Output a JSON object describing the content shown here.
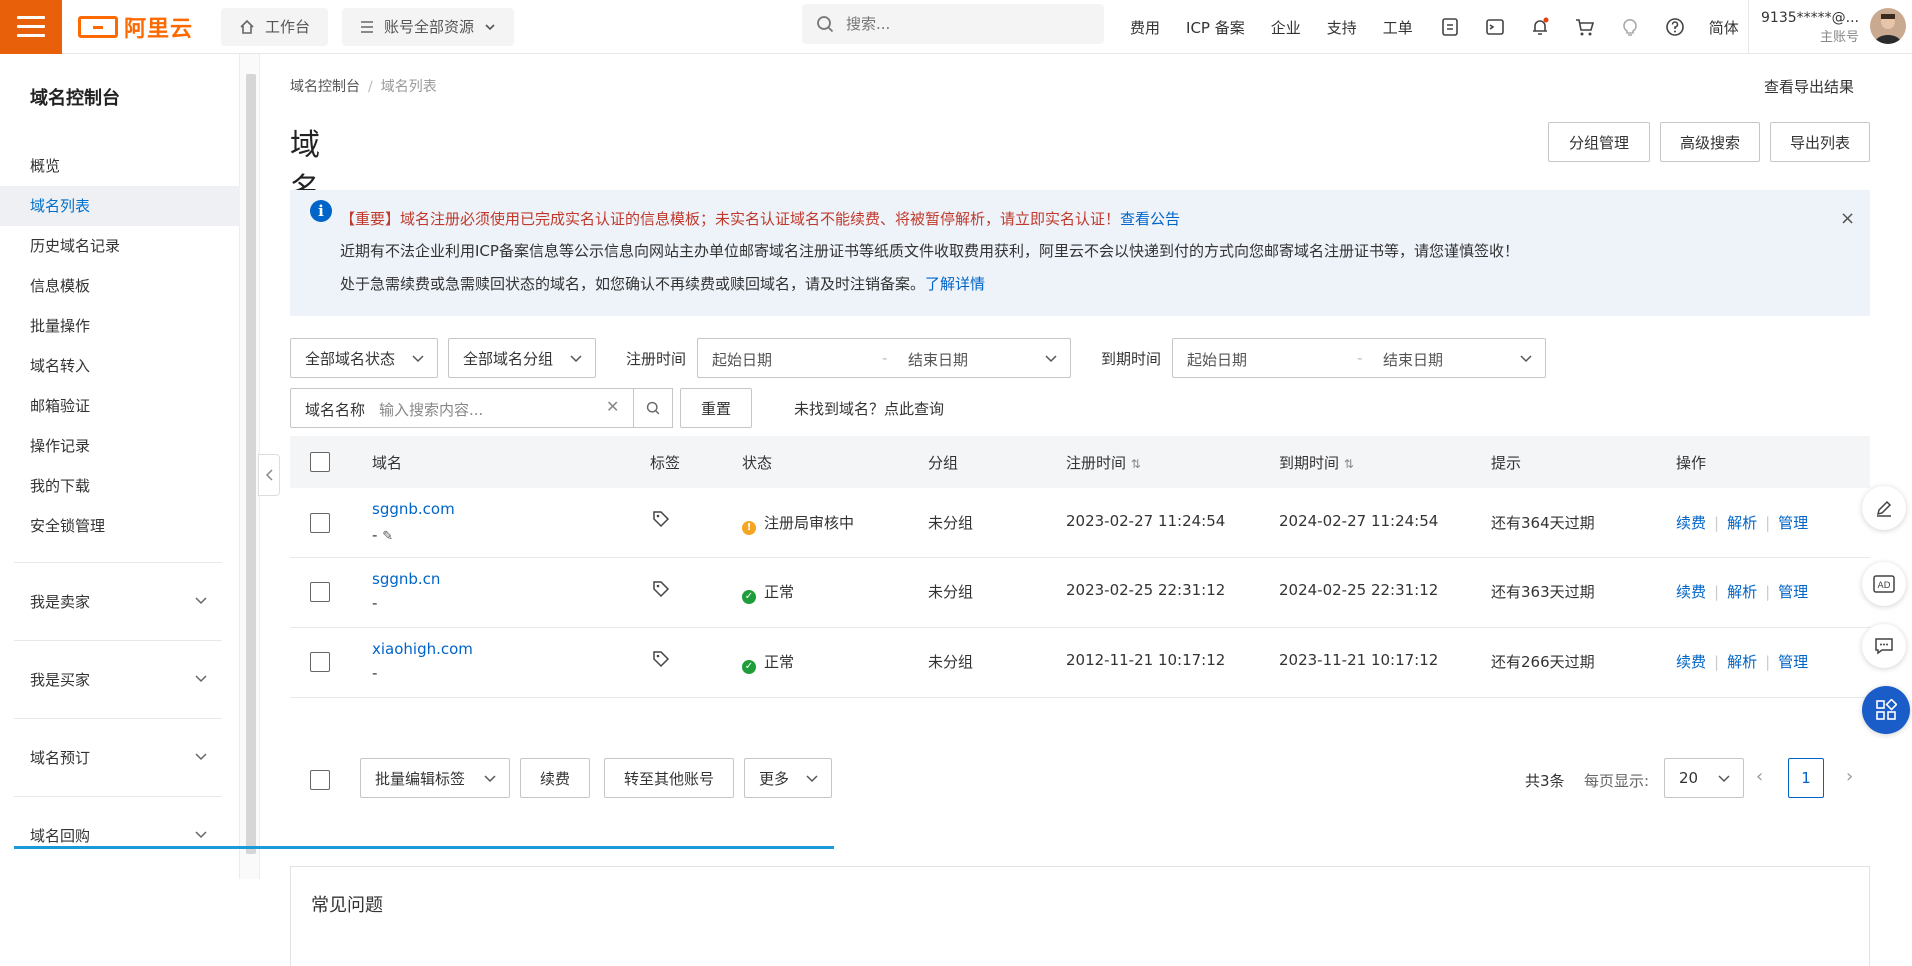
{
  "topbar": {
    "brand": "阿里云",
    "workbench": "工作台",
    "resources": "账号全部资源",
    "search_placeholder": "搜索...",
    "links": [
      "费用",
      "ICP 备案",
      "企业",
      "支持",
      "工单"
    ],
    "lang": "简体",
    "account_name": "9135*****@...",
    "account_type": "主账号"
  },
  "sidebar": {
    "title": "域名控制台",
    "items": [
      {
        "label": "概览",
        "active": false
      },
      {
        "label": "域名列表",
        "active": true
      },
      {
        "label": "历史域名记录",
        "active": false
      },
      {
        "label": "信息模板",
        "active": false
      },
      {
        "label": "批量操作",
        "active": false
      },
      {
        "label": "域名转入",
        "active": false
      },
      {
        "label": "邮箱验证",
        "active": false
      },
      {
        "label": "操作记录",
        "active": false
      },
      {
        "label": "我的下载",
        "active": false
      },
      {
        "label": "安全锁管理",
        "active": false
      }
    ],
    "groups": [
      "我是卖家",
      "我是买家",
      "域名预订",
      "域名回购"
    ]
  },
  "breadcrumb": {
    "root": "域名控制台",
    "current": "域名列表"
  },
  "export_result": "查看导出结果",
  "page_title": "域名列表",
  "header_buttons": {
    "group": "分组管理",
    "advanced": "高级搜索",
    "export": "导出列表"
  },
  "notice": {
    "line1": "【重要】域名注册必须使用已完成实名认证的信息模板；未实名认证域名不能续费、将被暂停解析，请立即实名认证！",
    "line1_link": "查看公告",
    "line2": "近期有不法企业利用ICP备案信息等公示信息向网站主办单位邮寄域名注册证书等纸质文件收取费用获利，阿里云不会以快递到付的方式向您邮寄域名注册证书等，请您谨慎签收！",
    "line3": "处于急需续费或急需赎回状态的域名，如您确认不再续费或赎回域名，请及时注销备案。",
    "line3_link": "了解详情",
    "close": "×"
  },
  "filters": {
    "status": "全部域名状态",
    "group": "全部域名分组",
    "reg_label": "注册时间",
    "exp_label": "到期时间",
    "start_placeholder": "起始日期",
    "end_placeholder": "结束日期",
    "date_sep": "-",
    "name_label": "域名名称",
    "name_placeholder": "输入搜索内容...",
    "reset": "重置",
    "not_found": "未找到域名？点此查询"
  },
  "table": {
    "headers": {
      "domain": "域名",
      "tag": "标签",
      "status": "状态",
      "group": "分组",
      "reg": "注册时间",
      "exp": "到期时间",
      "tip": "提示",
      "ops": "操作"
    },
    "rows": [
      {
        "domain": "sggnb.com",
        "sub": "-",
        "status": "注册局审核中",
        "status_color": "#f5a623",
        "group": "未分组",
        "reg": "2023-02-27 11:24:54",
        "exp": "2024-02-27 11:24:54",
        "tip": "还有364天过期"
      },
      {
        "domain": "sggnb.cn",
        "sub": "-",
        "status": "正常",
        "status_color": "#1e9e3a",
        "group": "未分组",
        "reg": "2023-02-25 22:31:12",
        "exp": "2024-02-25 22:31:12",
        "tip": "还有363天过期"
      },
      {
        "domain": "xiaohigh.com",
        "sub": "-",
        "status": "正常",
        "status_color": "#1e9e3a",
        "group": "未分组",
        "reg": "2012-11-21 10:17:12",
        "exp": "2023-11-21 10:17:12",
        "tip": "还有266天过期"
      }
    ],
    "ops": {
      "renew": "续费",
      "dns": "解析",
      "manage": "管理"
    }
  },
  "bulk": {
    "tag": "批量编辑标签",
    "renew": "续费",
    "transfer": "转至其他账号",
    "more": "更多"
  },
  "pager": {
    "total": "共3条",
    "per_page_label": "每页显示:",
    "per_page": "20",
    "page": "1"
  },
  "faq": {
    "title": "常见问题"
  }
}
